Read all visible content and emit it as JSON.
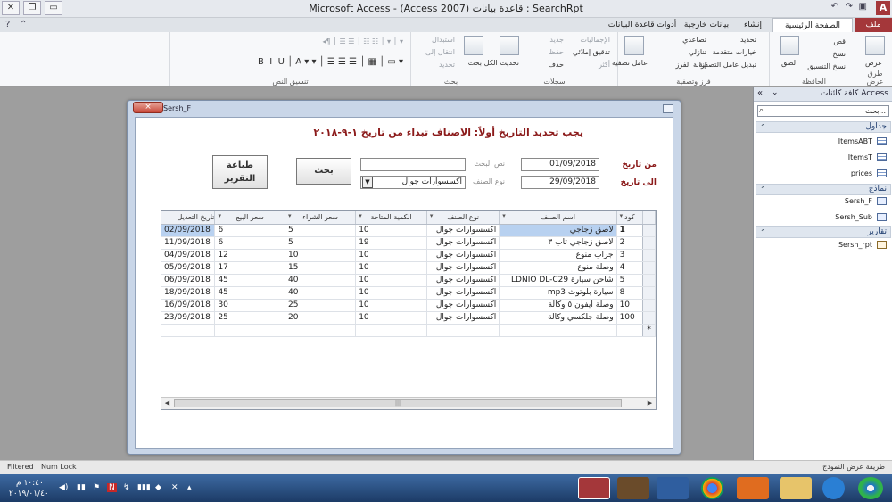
{
  "window": {
    "title": "Microsoft Access - (Access 2007) قاعدة بيانات : SearchRpt",
    "app_letter": "A"
  },
  "tabs": [
    {
      "label": "ملف"
    },
    {
      "label": "الصفحة الرئيسية"
    },
    {
      "label": "إنشاء"
    },
    {
      "label": "بيانات خارجية"
    },
    {
      "label": "أدوات قاعدة البيانات"
    }
  ],
  "ribbon": {
    "groups": {
      "views": "طرق عرض",
      "clipboard": "الحافظة",
      "sort_filter": "فرز وتصفية",
      "records": "سجلات",
      "find": "بحث",
      "text_format": "تنسيق النص"
    },
    "items": {
      "view": "عرض",
      "paste": "لصق",
      "cut": "قص",
      "copy": "نسخ",
      "format_painter": "نسخ التنسيق",
      "filter": "عامل تصفية",
      "ascending": "تصاعدي",
      "descending": "تنازلي",
      "remove_sort": "إزالة الفرز",
      "selection": "تحديد",
      "advanced": "خيارات متقدمة",
      "toggle_filter": "تبديل عامل التصفية",
      "refresh_all": "تحديث الكل",
      "new": "جديد",
      "save": "حفظ",
      "delete": "حذف",
      "totals": "الإجماليات",
      "spelling": "تدقيق إملائي",
      "more": "أكثر",
      "find": "بحث",
      "replace": "استبدال",
      "goto": "انتقال إلى",
      "select": "تحديد"
    }
  },
  "nav": {
    "header": "كافة كائنات Access",
    "search_placeholder": "بحث...",
    "sections": [
      {
        "label": "جداول",
        "items": [
          "ItemsABT",
          "ItemsT",
          "prices"
        ]
      },
      {
        "label": "نماذج",
        "items": [
          "Sersh_F",
          "Sersh_Sub"
        ]
      },
      {
        "label": "تقارير",
        "items": [
          "Sersh_rpt"
        ]
      }
    ]
  },
  "form": {
    "name": "Sersh_F",
    "close_symbol": "×",
    "heading": "يجب تحديد التاريخ أولاً: الاصناف تبداء من تاريخ ١-٩-٢٠١٨",
    "from_date_label": "من تاريخ",
    "to_date_label": "الى تاريخ",
    "from_date": "01/09/2018",
    "to_date": "29/09/2018",
    "search_text_label": "نص البحث",
    "search_text": "",
    "type_label": "نوع الصنف",
    "type_value": "اكسسوارات جوال",
    "search_button": "بحث",
    "print_button_line1": "طباعة",
    "print_button_line2": "التقرير"
  },
  "datasheet": {
    "headers": [
      "كود",
      "اسم الصنف",
      "نوع الصنف",
      "الكمية المتاحة",
      "سعر الشراء",
      "سعر البيع",
      "تاريخ التعديل"
    ],
    "rows": [
      {
        "code": "1",
        "name": "لاصق زجاجي",
        "type": "اكسسوارات جوال",
        "qty": "10",
        "buy": "5",
        "sell": "6",
        "date": "02/09/2018"
      },
      {
        "code": "2",
        "name": "لاصق زجاجي تاب ٣",
        "type": "اكسسوارات جوال",
        "qty": "19",
        "buy": "5",
        "sell": "6",
        "date": "11/09/2018"
      },
      {
        "code": "3",
        "name": "جراب منوع",
        "type": "اكسسوارات جوال",
        "qty": "10",
        "buy": "10",
        "sell": "12",
        "date": "04/09/2018"
      },
      {
        "code": "4",
        "name": "وصلة منوع",
        "type": "اكسسوارات جوال",
        "qty": "10",
        "buy": "15",
        "sell": "17",
        "date": "05/09/2018"
      },
      {
        "code": "5",
        "name": "شاحن سيارة LDNIO DL-C29",
        "type": "اكسسوارات جوال",
        "qty": "10",
        "buy": "40",
        "sell": "45",
        "date": "06/09/2018"
      },
      {
        "code": "8",
        "name": "سيارة بلوتوث mp3",
        "type": "اكسسوارات جوال",
        "qty": "10",
        "buy": "40",
        "sell": "45",
        "date": "18/09/2018"
      },
      {
        "code": "10",
        "name": "وصلة ايفون ٥ وكالة",
        "type": "اكسسوارات جوال",
        "qty": "10",
        "buy": "25",
        "sell": "30",
        "date": "16/09/2018"
      },
      {
        "code": "100",
        "name": "وصلة جلكسي وكالة",
        "type": "اكسسوارات جوال",
        "qty": "10",
        "buy": "20",
        "sell": "25",
        "date": "23/09/2018"
      }
    ],
    "new_row_marker": "*"
  },
  "status": {
    "left1": "Filtered",
    "left2": "Num Lock",
    "right": "طريقة عرض النموذج"
  },
  "taskbar": {
    "time": "١٠:٤٠ م",
    "date": "٢٠١٩/٠١/٤٠"
  },
  "colors": {
    "accent_file": "#a4373a",
    "heading_red": "#8b1a1a",
    "selection": "#b8d1f0"
  }
}
